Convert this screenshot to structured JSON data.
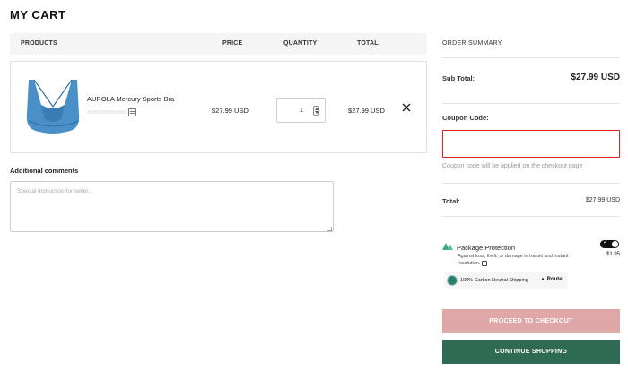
{
  "page": {
    "title": "MY CART"
  },
  "cart": {
    "columns": {
      "products": "PRODUCTS",
      "price": "PRICE",
      "quantity": "QUANTITY",
      "total": "TOTAL"
    },
    "items": [
      {
        "name": "AUROLA Mercury Sports Bra",
        "price": "$27.99 USD",
        "quantity": "1",
        "total": "$27.99 USD"
      }
    ]
  },
  "comments": {
    "label": "Additional comments",
    "placeholder": "Special instruction for seller..."
  },
  "summary": {
    "title": "ORDER SUMMARY",
    "subtotal_label": "Sub Total:",
    "subtotal_value": "$27.99 USD",
    "coupon_label": "Coupon Code:",
    "coupon_value": "",
    "coupon_hint": "Coupon code will be applied on the checkout page",
    "total_label": "Total:",
    "total_value": "$27.99 USD"
  },
  "protection": {
    "title": "Package Protection",
    "description": "Against loss, theft, or damage in transit and instant resolution.",
    "price": "$1.95",
    "enabled": true,
    "carbon_text": "100% Carbon Neutral Shipping",
    "route_label": "Route"
  },
  "buttons": {
    "checkout": "PROCEED TO CHECKOUT",
    "continue": "CONTINUE SHOPPING"
  },
  "colors": {
    "checkout_bg": "#dfa7a8",
    "continue_bg": "#2f6b52",
    "coupon_border": "#e0201f",
    "product_blue": "#4a90c8"
  }
}
